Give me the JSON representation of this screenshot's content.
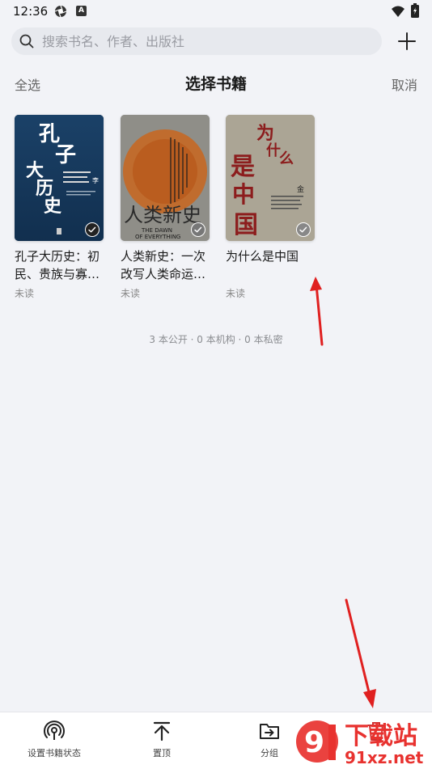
{
  "status_bar": {
    "time": "12:36",
    "badge_letter": "A"
  },
  "search": {
    "placeholder": "搜索书名、作者、出版社"
  },
  "header": {
    "select_all": "全选",
    "title": "选择书籍",
    "cancel": "取消"
  },
  "books": [
    {
      "title": "孔子大历史：初民、贵族与寡…",
      "status": "未读",
      "cover_text": "孔子大历史",
      "cover_author": "李硕",
      "selected": true
    },
    {
      "title": "人类新史：一次改写人类命运…",
      "status": "未读",
      "cover_text": "人类新史",
      "cover_subtitle": "THE DAWN OF EVERYTHING",
      "selected": true
    },
    {
      "title": "为什么是中国",
      "status": "未读",
      "cover_text": "为什么是中国",
      "cover_author": "金一南",
      "selected": true
    }
  ],
  "summary": "3 本公开 · 0 本机构 · 0 本私密",
  "bottom_nav": [
    {
      "label": "设置书籍状态",
      "icon": "broadcast-icon"
    },
    {
      "label": "置顶",
      "icon": "pin-top-icon"
    },
    {
      "label": "分组",
      "icon": "folder-move-icon"
    },
    {
      "label": "",
      "icon": "delete-icon"
    }
  ],
  "watermark": {
    "text_top": "下载站",
    "text_bottom": "91xz.net"
  },
  "colors": {
    "background": "#f2f3f7",
    "arrow": "#e02020",
    "watermark": "#e8322f"
  }
}
